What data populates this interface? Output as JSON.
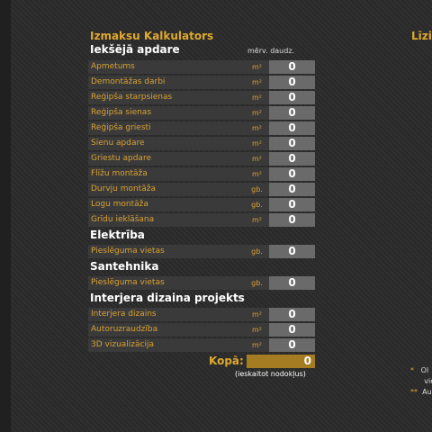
{
  "title": "Izmaksu Kalkulators",
  "title_right": "Līzi",
  "columns": {
    "unit_qty": "mērv. daudz."
  },
  "sections": [
    {
      "name": "Iekšējā apdare",
      "rows": [
        {
          "label": "Apmetums",
          "unit": "m²",
          "value": "0"
        },
        {
          "label": "Demontāžas darbi",
          "unit": "m²",
          "value": "0"
        },
        {
          "label": "Reģipša starpsienas",
          "unit": "m²",
          "value": "0"
        },
        {
          "label": "Reģipša sienas",
          "unit": "m²",
          "value": "0"
        },
        {
          "label": "Reģipša griesti",
          "unit": "m²",
          "value": "0"
        },
        {
          "label": "Sienu apdare",
          "unit": "m²",
          "value": "0"
        },
        {
          "label": "Griestu apdare",
          "unit": "m²",
          "value": "0"
        },
        {
          "label": "Flīžu montāža",
          "unit": "m²",
          "value": "0"
        },
        {
          "label": "Durvju montāža",
          "unit": "gb.",
          "value": "0"
        },
        {
          "label": "Logu montāža",
          "unit": "gb.",
          "value": "0"
        },
        {
          "label": "Grīdu ieklāšana",
          "unit": "m²",
          "value": "0"
        }
      ]
    },
    {
      "name": "Elektrība",
      "rows": [
        {
          "label": "Pieslēguma vietas",
          "unit": "gb.",
          "value": "0"
        }
      ]
    },
    {
      "name": "Santehnika",
      "rows": [
        {
          "label": "Pieslēguma vietas",
          "unit": "gb.",
          "value": "0"
        }
      ]
    },
    {
      "name": "Interjera dizaina projekts",
      "rows": [
        {
          "label": "Interjera dizains",
          "unit": "m²",
          "value": "0"
        },
        {
          "label": "Autoruzraudzība",
          "unit": "m²",
          "value": "0"
        },
        {
          "label": "3D vizualizācija",
          "unit": "m²",
          "value": "0"
        }
      ]
    }
  ],
  "total": {
    "label": "Kopā:",
    "value": "0",
    "note": "(ieskaitot nodokļus)"
  },
  "notes": [
    {
      "marker": "*",
      "text": "Ol"
    },
    {
      "marker": "",
      "text": "vie"
    },
    {
      "marker": "**",
      "text": "Au"
    }
  ]
}
